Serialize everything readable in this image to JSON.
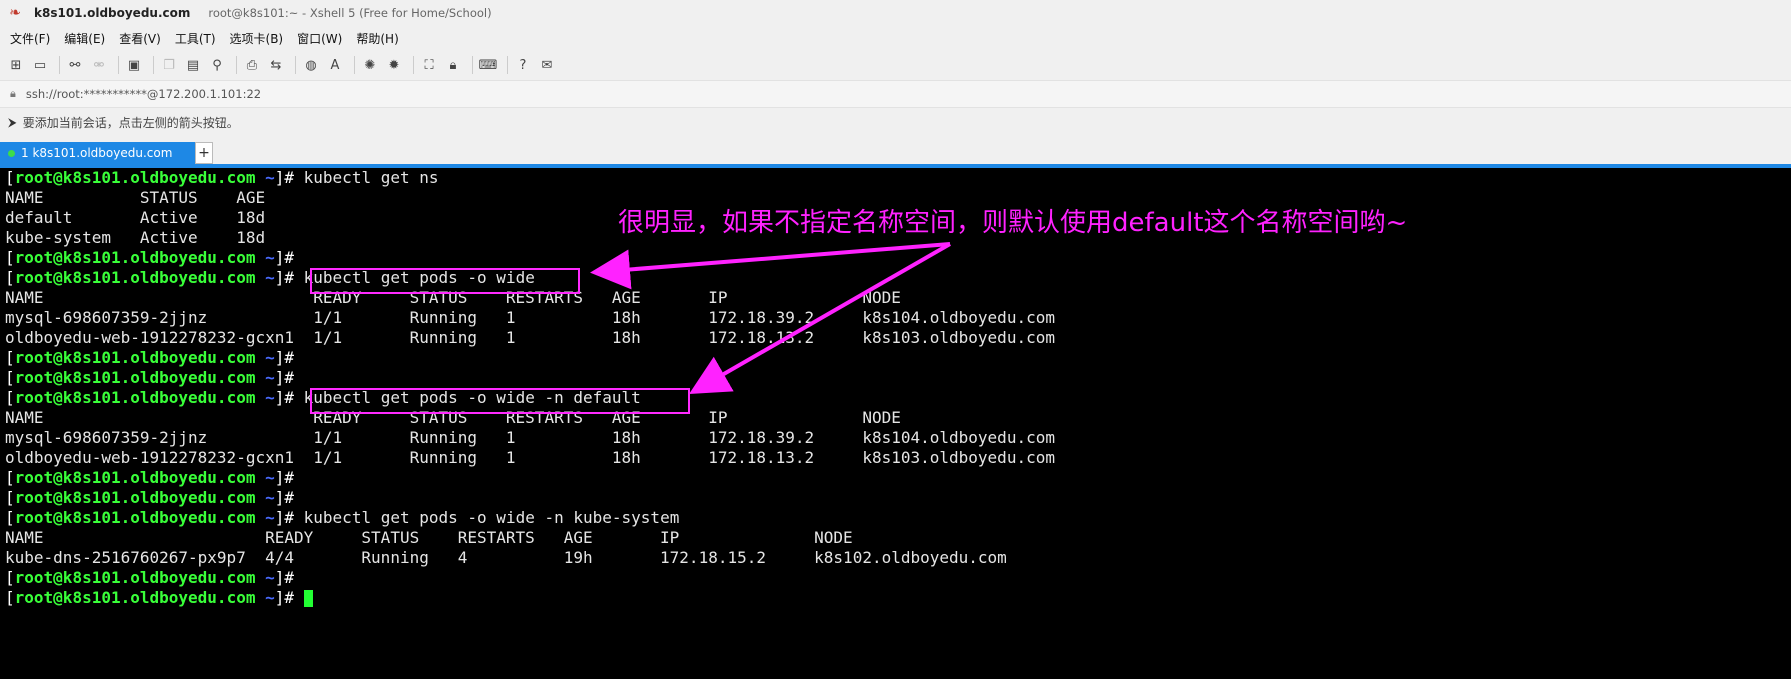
{
  "window": {
    "host_title": "k8s101.oldboyedu.com",
    "subtitle": "root@k8s101:~ - Xshell 5 (Free for Home/School)"
  },
  "menu": [
    "文件(F)",
    "编辑(E)",
    "查看(V)",
    "工具(T)",
    "选项卡(B)",
    "窗口(W)",
    "帮助(H)"
  ],
  "address": "ssh://root:***********@172.200.1.101:22",
  "hint": "要添加当前会话，点击左侧的箭头按钮。",
  "tab": {
    "label": "1 k8s101.oldboyedu.com",
    "add": "+"
  },
  "prompt": {
    "open": "[",
    "user": "root@k8s101.oldboyedu.com",
    "path": "~",
    "close": "]#"
  },
  "terminal": {
    "l0": " kubectl get ns",
    "l1": "NAME          STATUS    AGE",
    "l2": "default       Active    18d",
    "l3": "kube-system   Active    18d",
    "l5": " kubectl get pods -o wide",
    "l6": "NAME                            READY     STATUS    RESTARTS   AGE       IP              NODE",
    "l7": "mysql-698607359-2jjnz           1/1       Running   1          18h       172.18.39.2     k8s104.oldboyedu.com",
    "l8": "oldboyedu-web-1912278232-gcxn1  1/1       Running   1          18h       172.18.13.2     k8s103.oldboyedu.com",
    "l11": " kubectl get pods -o wide -n default",
    "l12": "NAME                            READY     STATUS    RESTARTS   AGE       IP              NODE",
    "l13": "mysql-698607359-2jjnz           1/1       Running   1          18h       172.18.39.2     k8s104.oldboyedu.com",
    "l14": "oldboyedu-web-1912278232-gcxn1  1/1       Running   1          18h       172.18.13.2     k8s103.oldboyedu.com",
    "l17": " kubectl get pods -o wide -n kube-system",
    "l18": "NAME                       READY     STATUS    RESTARTS   AGE       IP              NODE",
    "l19": "kube-dns-2516760267-px9p7  4/4       Running   4          19h       172.18.15.2     k8s102.oldboyedu.com"
  },
  "annotation": "很明显，如果不指定名称空间，则默认使用default这个名称空间哟~",
  "colors": {
    "annotation": "#ff22ff",
    "prompt_user": "#39ff39",
    "prompt_path": "#4a6bff",
    "tab": "#1e88e5",
    "cursor": "#22ff33"
  }
}
